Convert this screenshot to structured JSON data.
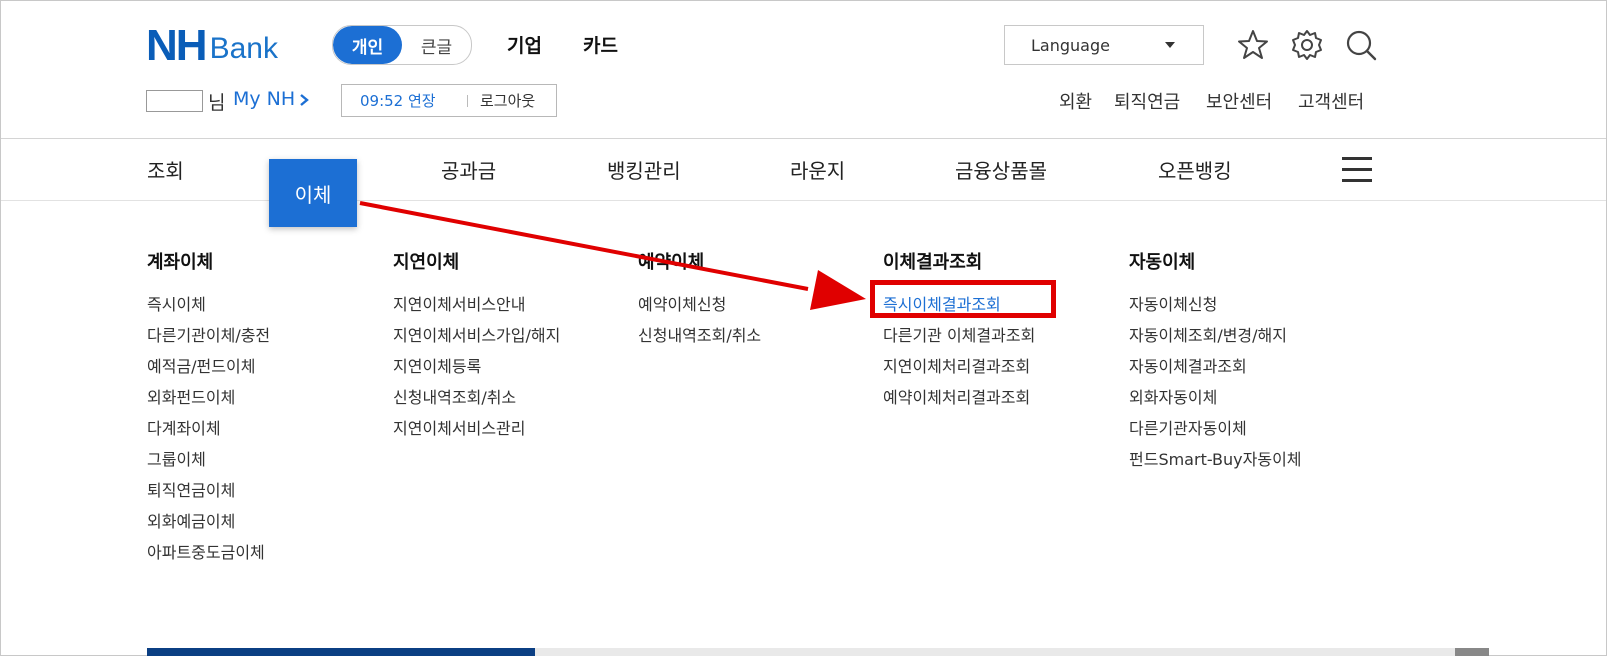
{
  "header": {
    "logo_nh": "NH",
    "logo_bank": "Bank",
    "toggle": {
      "active": "개인",
      "inactive": "큰글"
    },
    "top_nav": [
      "기업",
      "카드"
    ],
    "language": "Language",
    "greeting_suffix": "님",
    "my_nh": "My NH",
    "session_time": "09:52 연장",
    "logout": "로그아웃",
    "utility_links": [
      "외환",
      "퇴직연금",
      "보안센터",
      "고객센터"
    ],
    "icons": [
      "star-icon",
      "gear-icon",
      "search-icon"
    ]
  },
  "main_nav": {
    "items": [
      "조회",
      "이체",
      "공과금",
      "뱅킹관리",
      "라운지",
      "금융상품몰",
      "오픈뱅킹"
    ],
    "active": "이체"
  },
  "mega_menu": {
    "columns": [
      {
        "title": "계좌이체",
        "items": [
          "즉시이체",
          "다른기관이체/충전",
          "예적금/펀드이체",
          "외화펀드이체",
          "다계좌이체",
          "그룹이체",
          "퇴직연금이체",
          "외화예금이체",
          "아파트중도금이체"
        ]
      },
      {
        "title": "지연이체",
        "items": [
          "지연이체서비스안내",
          "지연이체서비스가입/해지",
          "지연이체등록",
          "신청내역조회/취소",
          "지연이체서비스관리"
        ]
      },
      {
        "title": "예약이체",
        "items": [
          "예약이체신청",
          "신청내역조회/취소"
        ]
      },
      {
        "title": "이체결과조회",
        "items": [
          "즉시이체결과조회",
          "다른기관 이체결과조회",
          "지연이체처리결과조회",
          "예약이체처리결과조회"
        ]
      },
      {
        "title": "자동이체",
        "items": [
          "자동이체신청",
          "자동이체조회/변경/해지",
          "자동이체결과조회",
          "외화자동이체",
          "다른기관자동이체",
          "펀드Smart-Buy자동이체"
        ]
      }
    ],
    "highlighted": "즉시이체결과조회"
  },
  "colors": {
    "brand": "#0a5db8",
    "accent": "#1c6fd4",
    "annotation": "#e00000"
  }
}
